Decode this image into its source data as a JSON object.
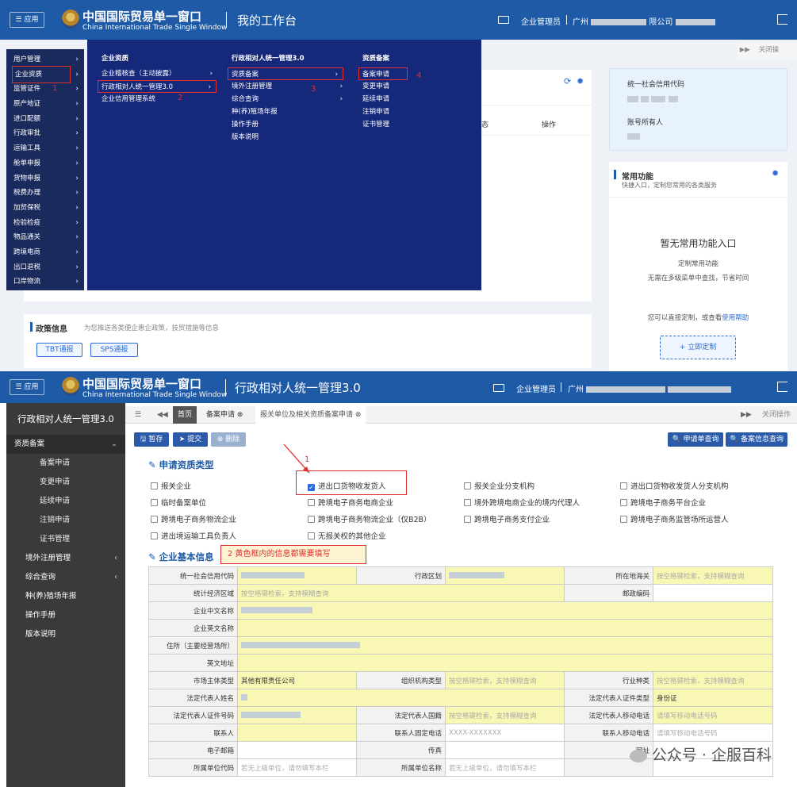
{
  "top": {
    "app_label": "应用",
    "brand_cn": "中国国际贸易单一窗口",
    "brand_en": "China International Trade Single Window",
    "page_title": "我的工作台",
    "user_role": "企业管理员",
    "company_prefix": "广州",
    "company_suffix": "限公司",
    "close_ops": "关闭操",
    "sidebar": [
      "用户管理",
      "企业资质",
      "监管证件",
      "原产地证",
      "进口配额",
      "行政审批",
      "运输工具",
      "舱单申报",
      "货物申报",
      "税费办理",
      "加贸保税",
      "检验检疫",
      "物品通关",
      "跨境电商",
      "出口退税",
      "口岸物流"
    ],
    "mega": {
      "col1": {
        "head": "企业资质",
        "items": [
          "企业稽核查（主动披露）",
          "行政相对人统一管理3.0",
          "企业信用管理系统"
        ]
      },
      "col2": {
        "head": "行政相对人统一管理3.0",
        "items": [
          "资质备案",
          "境外注册管理",
          "综合查询",
          "种(养)殖场年报",
          "操作手册",
          "版本说明"
        ]
      },
      "col3": {
        "head": "资质备案",
        "items": [
          "备案申请",
          "变更申请",
          "延续申请",
          "注销申请",
          "证书管理"
        ]
      }
    },
    "markers": [
      "1",
      "2",
      "3",
      "4"
    ],
    "table_cols": [
      "态",
      "操作"
    ],
    "credit_code_label": "统一社会信用代码",
    "owner_label": "账号所有人",
    "common": {
      "title": "常用功能",
      "sub": "快捷入口，定制您常用的各类服务",
      "empty": "暂无常用功能入口",
      "line1": "定制常用功能",
      "line2": "无需在多级菜单中查找，节省时间",
      "help_pre": "您可以直接定制，或查看",
      "help_link": "使用帮助",
      "custom_btn": "+ 立即定制"
    },
    "policy": {
      "title": "政策信息",
      "desc": "为您推送各类便企惠企政策，技贸措施等信息",
      "btn1": "TBT通报",
      "btn2": "SPS通报"
    }
  },
  "bot": {
    "app_label": "应用",
    "brand_cn": "中国国际贸易单一窗口",
    "brand_en": "China International Trade Single Window",
    "page_title": "行政相对人统一管理3.0",
    "user_role": "企业管理员",
    "company_prefix": "广州",
    "side_title": "行政相对人统一管理3.0",
    "side_group": "资质备案",
    "side_sub": [
      "备案申请",
      "变更申请",
      "延续申请",
      "注销申请",
      "证书管理"
    ],
    "side_more": [
      "境外注册管理",
      "综合查询",
      "种(养)殖场年报",
      "操作手册",
      "版本说明"
    ],
    "tabs": {
      "home": "首页",
      "t1": "备案申请",
      "t2": "报关单位及相关资质备案申请",
      "close_ops": "关闭操作"
    },
    "toolbar": {
      "save": "暂存",
      "submit": "提交",
      "delete": "删除",
      "query1": "申请单查询",
      "query2": "备案信息查询"
    },
    "sec1": "申请资质类型",
    "annot1": "1",
    "checks": [
      {
        "label": "报关企业",
        "on": false
      },
      {
        "label": "进出口货物收发货人",
        "on": true
      },
      {
        "label": "报关企业分支机构",
        "on": false
      },
      {
        "label": "进出口货物收发货人分支机构",
        "on": false
      },
      {
        "label": "临时备案单位",
        "on": false
      },
      {
        "label": "跨境电子商务电商企业",
        "on": false
      },
      {
        "label": "境外跨境电商企业的境内代理人",
        "on": false
      },
      {
        "label": "跨境电子商务平台企业",
        "on": false
      },
      {
        "label": "跨境电子商务物流企业",
        "on": false
      },
      {
        "label": "跨境电子商务物流企业（仅B2B）",
        "on": false
      },
      {
        "label": "跨境电子商务支付企业",
        "on": false
      },
      {
        "label": "跨境电子商务监管场所运营人",
        "on": false
      },
      {
        "label": "进出境运输工具负责人",
        "on": false
      },
      {
        "label": "无报关权的其他企业",
        "on": false
      }
    ],
    "sec2": "企业基本信息",
    "annot2": "2 黄色框内的信息都需要填写",
    "form": {
      "r1": [
        "统一社会信用代码",
        "行政区划",
        "所在地海关",
        "按空格键检索，支持模糊查询"
      ],
      "r2": [
        "统计经济区域",
        "按空格键检索，支持模糊查询",
        "邮政编码"
      ],
      "r3": [
        "企业中文名称"
      ],
      "r4": [
        "企业英文名称"
      ],
      "r5": [
        "住所（主要经营场所）"
      ],
      "r6": [
        "英文地址"
      ],
      "r7": [
        "市场主体类型",
        "其他有限责任公司",
        "组织机构类型",
        "按空格键检索，支持模糊查询",
        "行业种类",
        "按空格键检索，支持模糊查询"
      ],
      "r8": [
        "法定代表人姓名",
        "法定代表人证件类型",
        "身份证"
      ],
      "r9": [
        "法定代表人证件号码",
        "法定代表人国籍",
        "按空格键检索，支持模糊查询",
        "法定代表人移动电话",
        "请填写移动电话号码"
      ],
      "r10": [
        "联系人",
        "联系人固定电话",
        "XXXX-XXXXXXX",
        "联系人移动电话",
        "请填写移动电话号码"
      ],
      "r11": [
        "电子邮箱",
        "传真",
        "网址"
      ],
      "r12": [
        "所属单位代码",
        "若无上级单位，请勿填写本栏",
        "所属单位名称",
        "若无上级单位，请勿填写本栏"
      ]
    }
  },
  "watermark": "公众号 · 企服百科"
}
